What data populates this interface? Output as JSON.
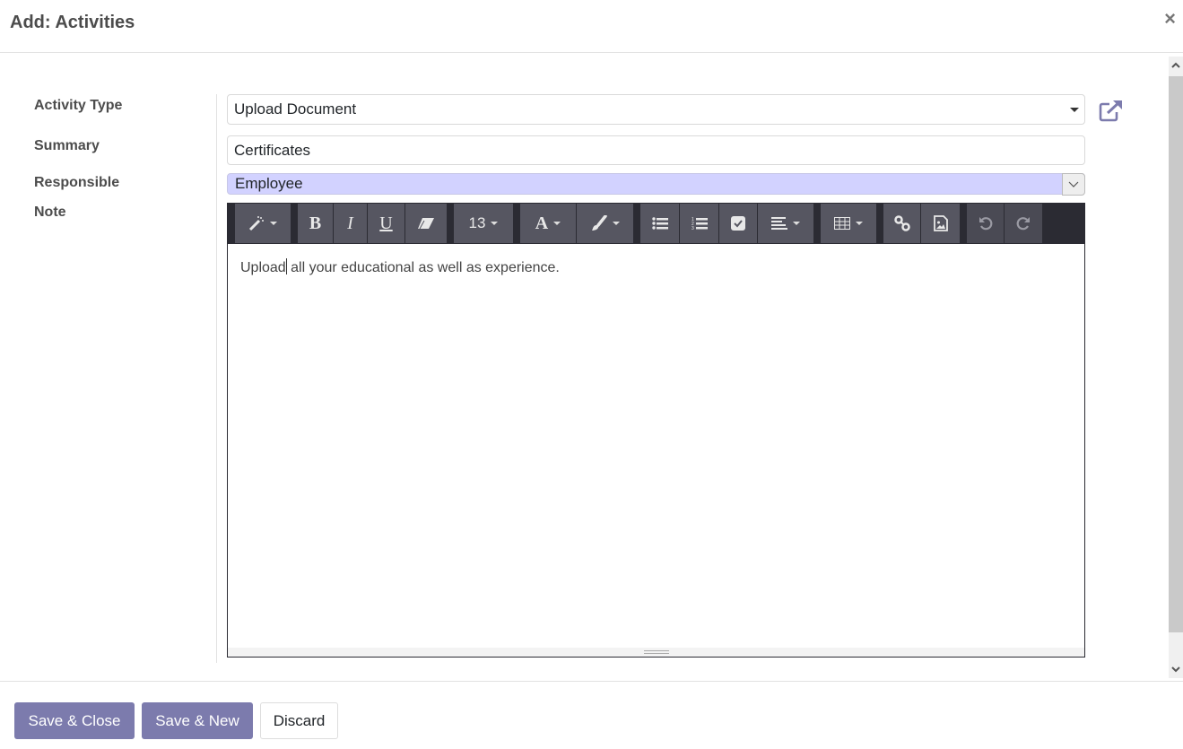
{
  "dialog": {
    "title": "Add: Activities",
    "close_label": "×"
  },
  "form": {
    "activity_type": {
      "label": "Activity Type",
      "value": "Upload Document"
    },
    "summary": {
      "label": "Summary",
      "value": "Certificates"
    },
    "responsible": {
      "label": "Responsible",
      "value": "Employee",
      "toggle": "∨"
    },
    "note": {
      "label": "Note",
      "content_before_cursor": "Upload",
      "content_after_cursor": " all your educational as well as experience."
    }
  },
  "toolbar": {
    "font_size": "13",
    "bold": "B",
    "italic": "I",
    "underline": "U",
    "font_color": "A"
  },
  "footer": {
    "save_close": "Save & Close",
    "save_new": "Save & New",
    "discard": "Discard"
  },
  "colors": {
    "primary": "#7c7bad",
    "responsible_highlight": "#d2d2ff",
    "toolbar_bg": "#565661"
  }
}
